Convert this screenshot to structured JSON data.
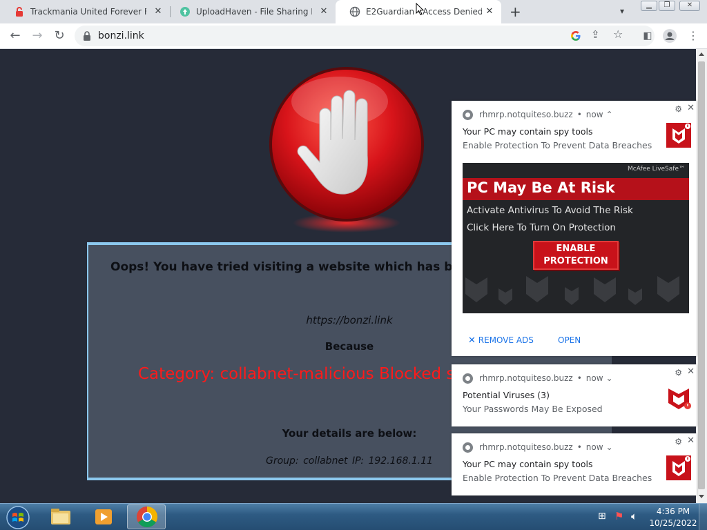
{
  "browser": {
    "tabs": [
      {
        "title": "Trackmania United Forever Free D",
        "favicon": "padlock-red-icon"
      },
      {
        "title": "UploadHaven - File Sharing Made",
        "favicon": "uploadhaven-icon"
      },
      {
        "title": "E2Guardian - Access Denied",
        "favicon": "globe-icon",
        "active": true
      }
    ],
    "new_tab_label": "+",
    "address": "bonzi.link"
  },
  "page": {
    "oops": "Oops! You have tried visiting a website which has been c",
    "blocked_url": "https://bonzi.link",
    "because": "Because",
    "category": "Category: collabnet-malicious  Blocked s",
    "details_heading": "Your details are below:",
    "details_line": "Group: collabnet   IP: 192.168.1.11"
  },
  "notifications": [
    {
      "source": "rhmrp.notquiteso.buzz",
      "time": "now",
      "chevron": "⌃",
      "title": "Your PC may contain spy tools",
      "body": "Enable Protection To Prevent Data Breaches",
      "ad": {
        "brand": "McAfee LiveSafe™",
        "headline": "PC May Be At Risk",
        "line1": "Activate Antivirus To Avoid The Risk",
        "line2": "Click Here To Turn On Protection",
        "button": "ENABLE\nPROTECTION"
      },
      "actions": {
        "remove_ads": "REMOVE ADS",
        "open": "OPEN"
      }
    },
    {
      "source": "rhmrp.notquiteso.buzz",
      "time": "now",
      "chevron": "⌄",
      "title": "Potential Viruses (3)",
      "body": "Your Passwords May Be Exposed"
    },
    {
      "source": "rhmrp.notquiteso.buzz",
      "time": "now",
      "chevron": "⌄",
      "title": "Your PC may contain spy tools",
      "body": "Enable Protection To Prevent Data Breaches"
    }
  ],
  "taskbar": {
    "time": "4:36 PM",
    "date": "10/25/2022"
  },
  "colors": {
    "page_bg": "#262b38",
    "panel_bg": "#47505f",
    "panel_border": "#8cc8ee",
    "category_red": "#ff1a1a",
    "mcafee_red": "#c8121a",
    "link_blue": "#1a73e8"
  }
}
